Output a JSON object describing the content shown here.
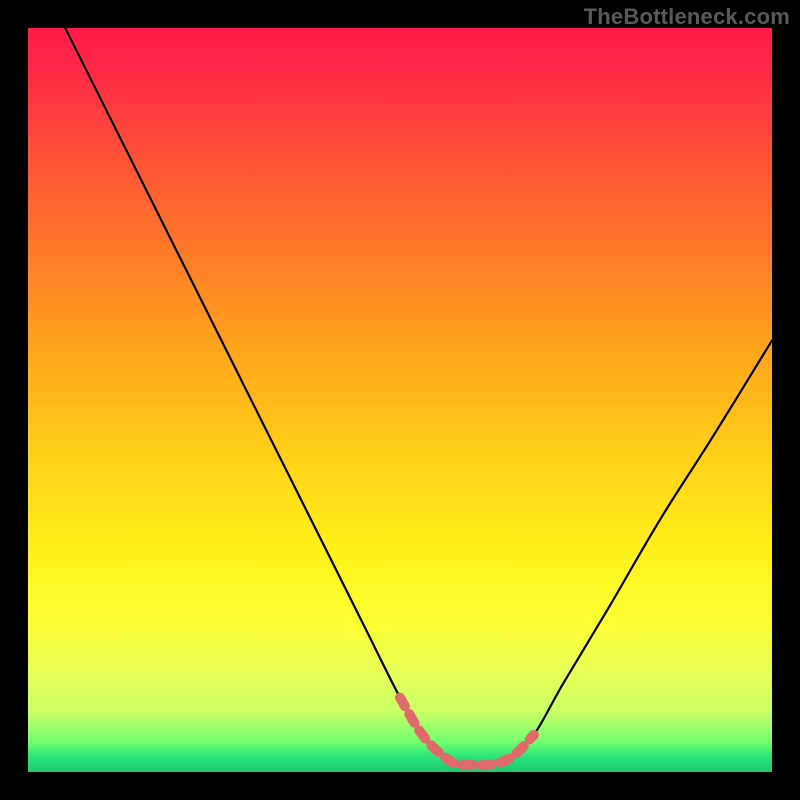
{
  "watermark": "TheBottleneck.com",
  "colors": {
    "frame": "#000000",
    "curve": "#000000",
    "highlight": "#e06a6a",
    "gradient_top": "#ff1a4b",
    "gradient_bottom": "#1ec86e"
  },
  "chart_data": {
    "type": "line",
    "title": "",
    "xlabel": "",
    "ylabel": "",
    "xlim": [
      0,
      100
    ],
    "ylim": [
      0,
      100
    ],
    "grid": false,
    "legend": false,
    "series": [
      {
        "name": "bottleneck-curve",
        "x": [
          5,
          10,
          15,
          20,
          25,
          30,
          35,
          40,
          45,
          50,
          53,
          56,
          58,
          60,
          62,
          65,
          68,
          72,
          78,
          85,
          92,
          100
        ],
        "y": [
          100,
          90,
          80,
          70,
          60,
          50,
          40,
          30,
          20,
          10,
          5,
          2,
          1,
          1,
          1,
          2,
          5,
          12,
          22,
          34,
          45,
          58
        ]
      }
    ],
    "highlight": {
      "name": "optimal-range",
      "x": [
        50,
        53,
        56,
        58,
        60,
        62,
        65,
        68
      ],
      "y": [
        10,
        5,
        2,
        1,
        1,
        1,
        2,
        5
      ],
      "style": "dashed",
      "color": "#e06a6a"
    },
    "background_gradient": {
      "orientation": "vertical",
      "stops": [
        {
          "pos": 0.0,
          "color": "#ff1a4b"
        },
        {
          "pos": 0.15,
          "color": "#ff4a3a"
        },
        {
          "pos": 0.35,
          "color": "#ff8a24"
        },
        {
          "pos": 0.58,
          "color": "#ffd21a"
        },
        {
          "pos": 0.8,
          "color": "#fbff33"
        },
        {
          "pos": 0.92,
          "color": "#c8ff66"
        },
        {
          "pos": 1.0,
          "color": "#1ec86e"
        }
      ]
    }
  }
}
